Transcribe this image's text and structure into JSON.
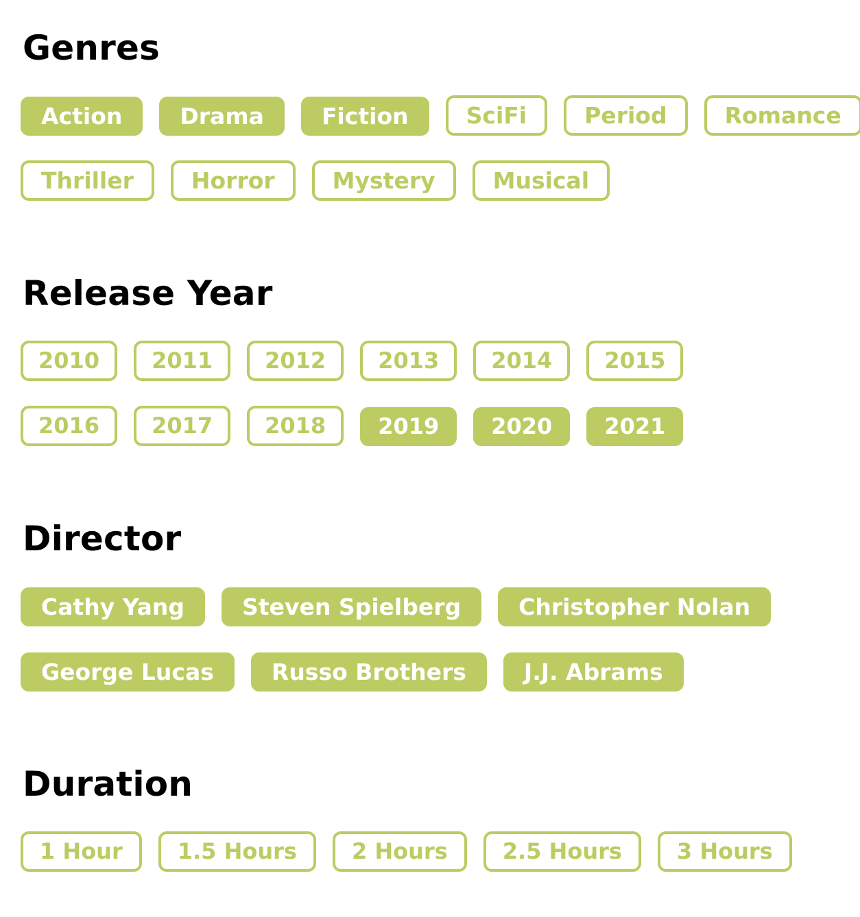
{
  "genres": {
    "title": "Genres",
    "row1": [
      {
        "label": "Action",
        "selected": true
      },
      {
        "label": "Drama",
        "selected": true
      },
      {
        "label": "Fiction",
        "selected": true
      },
      {
        "label": "SciFi",
        "selected": false
      },
      {
        "label": "Period",
        "selected": false
      },
      {
        "label": "Romance",
        "selected": false
      }
    ],
    "row2": [
      {
        "label": "Thriller",
        "selected": false
      },
      {
        "label": "Horror",
        "selected": false
      },
      {
        "label": "Mystery",
        "selected": false
      },
      {
        "label": "Musical",
        "selected": false
      }
    ]
  },
  "release_year": {
    "title": "Release Year",
    "row1": [
      {
        "label": "2010",
        "selected": false
      },
      {
        "label": "2011",
        "selected": false
      },
      {
        "label": "2012",
        "selected": false
      },
      {
        "label": "2013",
        "selected": false
      },
      {
        "label": "2014",
        "selected": false
      },
      {
        "label": "2015",
        "selected": false
      }
    ],
    "row2": [
      {
        "label": "2016",
        "selected": false
      },
      {
        "label": "2017",
        "selected": false
      },
      {
        "label": "2018",
        "selected": false
      },
      {
        "label": "2019",
        "selected": true
      },
      {
        "label": "2020",
        "selected": true
      },
      {
        "label": "2021",
        "selected": true
      }
    ]
  },
  "director": {
    "title": "Director",
    "row1": [
      {
        "label": "Cathy Yang",
        "selected": true
      },
      {
        "label": "Steven Spielberg",
        "selected": true
      },
      {
        "label": "Christopher Nolan",
        "selected": true
      }
    ],
    "row2": [
      {
        "label": "George Lucas",
        "selected": true
      },
      {
        "label": "Russo Brothers",
        "selected": true
      },
      {
        "label": "J.J. Abrams",
        "selected": true
      }
    ]
  },
  "duration": {
    "title": "Duration",
    "row1": [
      {
        "label": "1 Hour",
        "selected": false
      },
      {
        "label": "1.5 Hours",
        "selected": false
      },
      {
        "label": "2 Hours",
        "selected": false
      },
      {
        "label": "2.5 Hours",
        "selected": false
      },
      {
        "label": "3 Hours",
        "selected": false
      }
    ]
  },
  "colors": {
    "accent": "#bccc63",
    "text": "#000000",
    "background": "#ffffff"
  }
}
